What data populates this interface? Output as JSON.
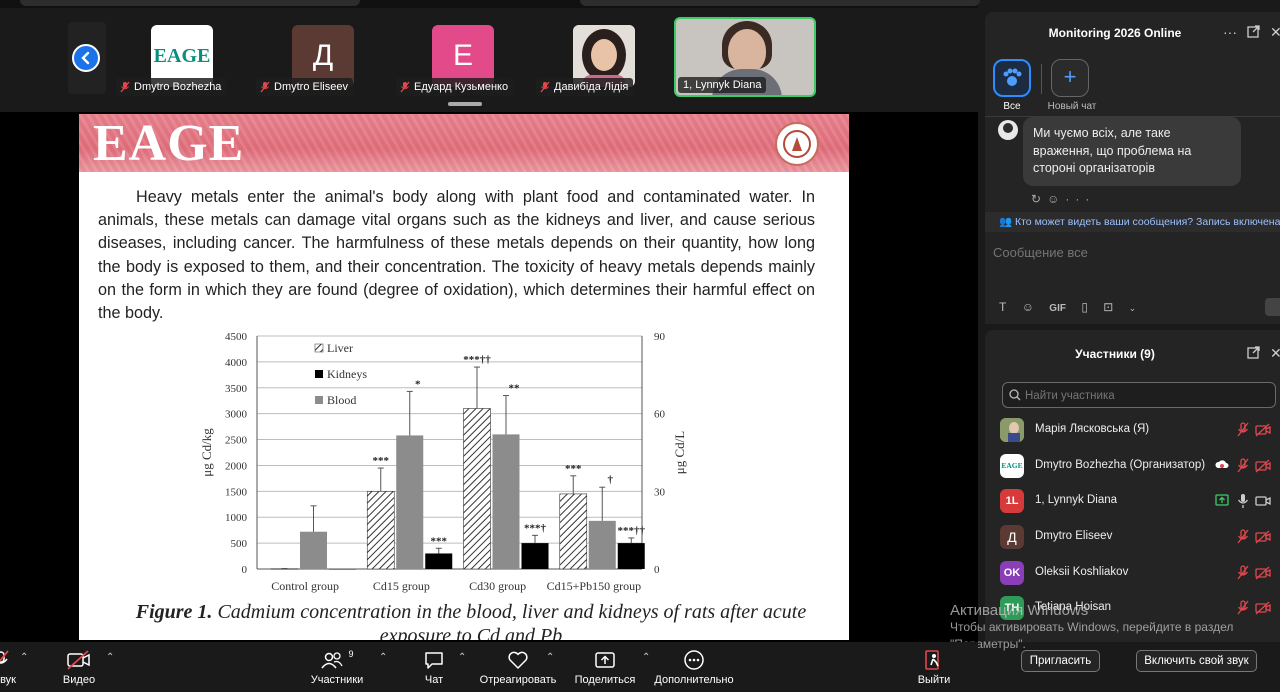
{
  "meeting": {
    "participants_strip": [
      {
        "name": "Dmytro Bozhezha",
        "avatar_text": "EAGE",
        "avatar_color": "#ffffff",
        "avatar_text_color": "#0a8f7c"
      },
      {
        "name": "Dmytro Eliseev",
        "avatar_text": "Д",
        "avatar_color": "#5a3a33",
        "avatar_text_color": "#ffffff"
      },
      {
        "name": "Едуард Кузьменко",
        "avatar_text": "E",
        "avatar_color": "#e24a8a",
        "avatar_text_color": "#ffffff"
      },
      {
        "name": "Давибіда Лідія",
        "avatar_text": "",
        "avatar_color": "#d9d2cc",
        "avatar_text_color": "#ffffff"
      }
    ],
    "active_speaker": {
      "name": "1, Lynnyk Diana"
    }
  },
  "slide": {
    "logo": "EAGE",
    "paragraph": "Heavy metals enter the animal's body along with plant food and contaminated water. In animals, these metals can damage vital organs such as the kidneys and liver, and cause serious diseases, including cancer. The harmfulness of these metals depends on their quantity, how long the body is exposed to them, and their concentration. The toxicity of heavy metals depends mainly on the form in which they are found (degree of oxidation), which determines their harmful effect on the body.",
    "caption_label": "Figure 1.",
    "caption_text": " Cadmium concentration in the blood, liver and kidneys of rats after acute exposure to Cd and Pb"
  },
  "chart_data": {
    "type": "bar",
    "categories": [
      "Control group",
      "Cd15 group",
      "Cd30 group",
      "Cd15+Pb150 group"
    ],
    "series": [
      {
        "name": "Liver",
        "values": [
          5,
          1500,
          3100,
          1450
        ],
        "errors": [
          5,
          450,
          800,
          350
        ],
        "axis": "left",
        "labels": [
          "",
          "***",
          "***††",
          "***"
        ]
      },
      {
        "name": "Blood",
        "values": [
          720,
          2580,
          2600,
          930
        ],
        "errors": [
          500,
          850,
          750,
          650
        ],
        "axis": "left",
        "labels": [
          "",
          "*",
          "**",
          "†"
        ]
      },
      {
        "name": "Kidneys",
        "values": [
          0,
          6,
          10,
          10
        ],
        "errors": [
          0,
          2,
          3,
          2
        ],
        "axis": "right",
        "labels": [
          "",
          "***",
          "***†",
          "***††"
        ]
      }
    ],
    "legend_order": [
      "Liver",
      "Kidneys",
      "Blood"
    ],
    "left_axis": {
      "label": "μg Cd/kg",
      "ylim": [
        0,
        4500
      ],
      "ticks": [
        0,
        500,
        1000,
        1500,
        2000,
        2500,
        3000,
        3500,
        4000,
        4500
      ]
    },
    "right_axis": {
      "label": "μg Cd/L",
      "ylim": [
        0,
        90
      ],
      "ticks": [
        0,
        30,
        60,
        90
      ]
    },
    "grid": true,
    "legend_position": "top-left"
  },
  "chat": {
    "title": "Monitoring 2026 Online",
    "tab_all": "Все",
    "tab_new": "Новый чат",
    "message": "Ми чуємо всіх, але таке враження, що проблема на стороні організаторів",
    "notice": "Кто может видеть ваши сообщения? Запись включена",
    "input_placeholder": "Сообщение все",
    "tool_gif": "GIF"
  },
  "participants_panel": {
    "title": "Участники (9)",
    "search_placeholder": "Найти участника",
    "rows": [
      {
        "name": "Марія Лясковська (Я)",
        "avatar_text": "",
        "avatar_color": "#c9a24a"
      },
      {
        "name": "Dmytro Bozhezha (Организатор)",
        "avatar_text": "EAGE",
        "avatar_color": "#ffffff"
      },
      {
        "name": "1, Lynnyk Diana",
        "avatar_text": "1L",
        "avatar_color": "#d63a3a"
      },
      {
        "name": "Dmytro Eliseev",
        "avatar_text": "Д",
        "avatar_color": "#5a3a33"
      },
      {
        "name": "Oleksii Koshliakov",
        "avatar_text": "OK",
        "avatar_color": "#8a3fb8"
      },
      {
        "name": "Tetiana Hoisan",
        "avatar_text": "TH",
        "avatar_color": "#2e9b58"
      }
    ],
    "invite_button": "Пригласить",
    "unmute_button": "Включить свой звук"
  },
  "watermark": {
    "title": "Активация Windows",
    "subtitle": "Чтобы активировать Windows, перейдите в раздел \"Параметры\"."
  },
  "toolbar": {
    "audio_label": "Звук",
    "video_label": "Видео",
    "participants_label": "Участники",
    "participants_count": "9",
    "chat_label": "Чат",
    "react_label": "Отреагировать",
    "share_label": "Поделиться",
    "more_label": "Дополнительно",
    "leave_label": "Выйти"
  },
  "colors": {
    "accent": "#2d8cff",
    "leave": "#e0484e",
    "active_border": "#3ccc67",
    "muted_red": "#e0484e"
  }
}
